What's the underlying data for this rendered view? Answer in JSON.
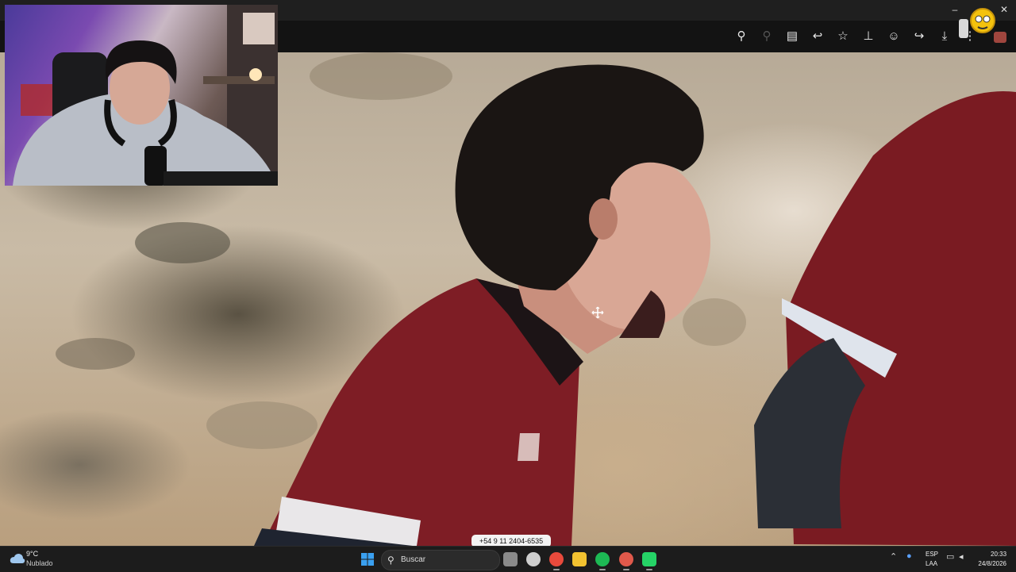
{
  "window": {
    "minimize_glyph": "–",
    "close_glyph": "✕"
  },
  "toolbar": {
    "icons": [
      {
        "name": "zoom-icon",
        "glyph": "⚲"
      },
      {
        "name": "zoom-out-icon",
        "glyph": "⚲"
      },
      {
        "name": "caption-icon",
        "glyph": "▤"
      },
      {
        "name": "reply-icon",
        "glyph": "↩"
      },
      {
        "name": "star-icon",
        "glyph": "☆"
      },
      {
        "name": "pin-icon",
        "glyph": "⊥"
      },
      {
        "name": "emoji-icon",
        "glyph": "☺"
      },
      {
        "name": "forward-icon",
        "glyph": "↪"
      },
      {
        "name": "download-icon",
        "glyph": "⤓"
      },
      {
        "name": "more-icon",
        "glyph": "⋮"
      }
    ]
  },
  "tooltip": {
    "text": "+54 9 11 2404-6535"
  },
  "taskbar": {
    "weather_temp": "9°C",
    "weather_desc": "Nublado",
    "search_placeholder": "Buscar",
    "search_glyph": "⚲",
    "tray_chevron": "⌃",
    "lang_line1": "ESP",
    "lang_line2": "LAA",
    "time": "20:33",
    "date": "24/8/2026",
    "apps": [
      {
        "name": "task-view-icon",
        "color": "#8a8a8a"
      },
      {
        "name": "app-icon-circle",
        "color": "#cfcfcf"
      },
      {
        "name": "chrome-icon",
        "color": "#e84a3c"
      },
      {
        "name": "file-explorer-icon",
        "color": "#f2c230"
      },
      {
        "name": "spotify-icon",
        "color": "#1db954"
      },
      {
        "name": "chrome-profile-icon",
        "color": "#e0594b"
      },
      {
        "name": "whatsapp-icon",
        "color": "#25d366"
      }
    ]
  },
  "colors": {
    "jersey": "#7e1d25",
    "accent_windows": "#3aa0f0"
  }
}
